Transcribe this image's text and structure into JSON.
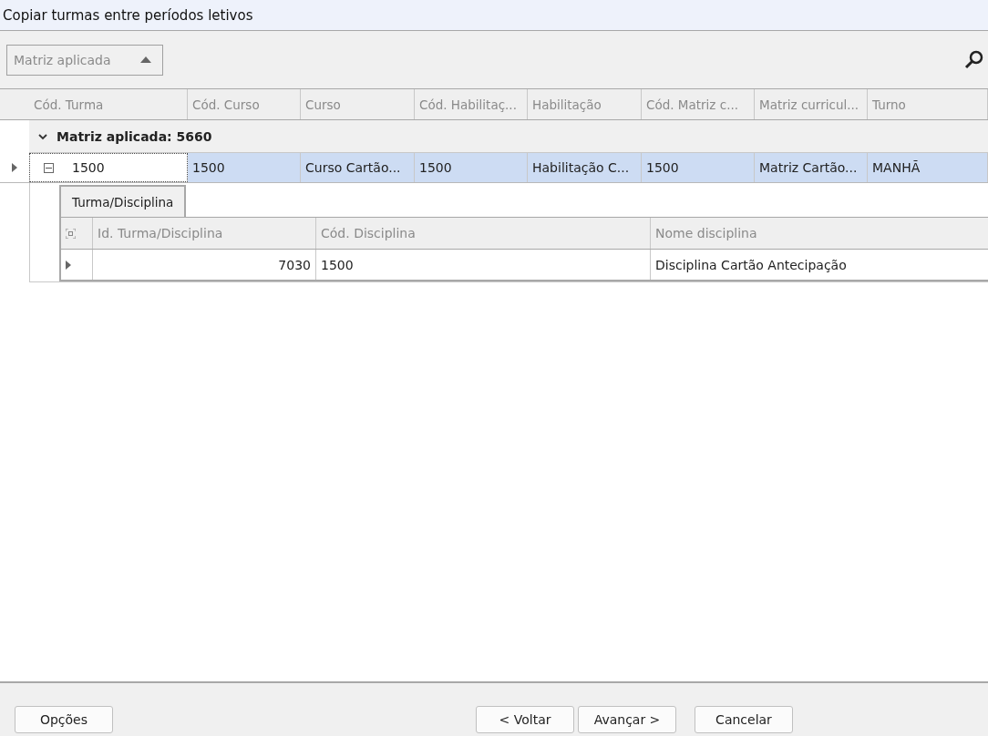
{
  "window": {
    "title": "Copiar turmas entre períodos letivos"
  },
  "group_panel": {
    "chips": [
      {
        "label": "Matriz aplicada",
        "sort_ascending": true
      }
    ]
  },
  "grid": {
    "columns": [
      "Cód. Turma",
      "Cód. Curso",
      "Curso",
      "Cód. Habilitaç...",
      "Habilitação",
      "Cód. Matriz c...",
      "Matriz curricul...",
      "Turno"
    ],
    "groups": [
      {
        "label": "Matriz aplicada: 5660",
        "expanded": true,
        "rows": [
          {
            "selected": true,
            "focused": true,
            "expanded": true,
            "cells": [
              "1500",
              "1500",
              "Curso Cartão...",
              "1500",
              "Habilitação C...",
              "1500",
              "Matriz Cartão...",
              "MANHÃ"
            ],
            "detail": {
              "tabs": [
                {
                  "label": "Turma/Disciplina",
                  "selected": true
                }
              ],
              "columns": [
                "Id. Turma/Disciplina",
                "Cód. Disciplina",
                "Nome disciplina"
              ],
              "rows": [
                {
                  "cells": [
                    "7030",
                    "1500",
                    "Disciplina Cartão Antecipação"
                  ]
                }
              ]
            }
          }
        ]
      }
    ]
  },
  "footer": {
    "left_buttons": [
      "Opções"
    ],
    "right_buttons": [
      "< Voltar",
      "Avançar >",
      "Cancelar"
    ]
  }
}
